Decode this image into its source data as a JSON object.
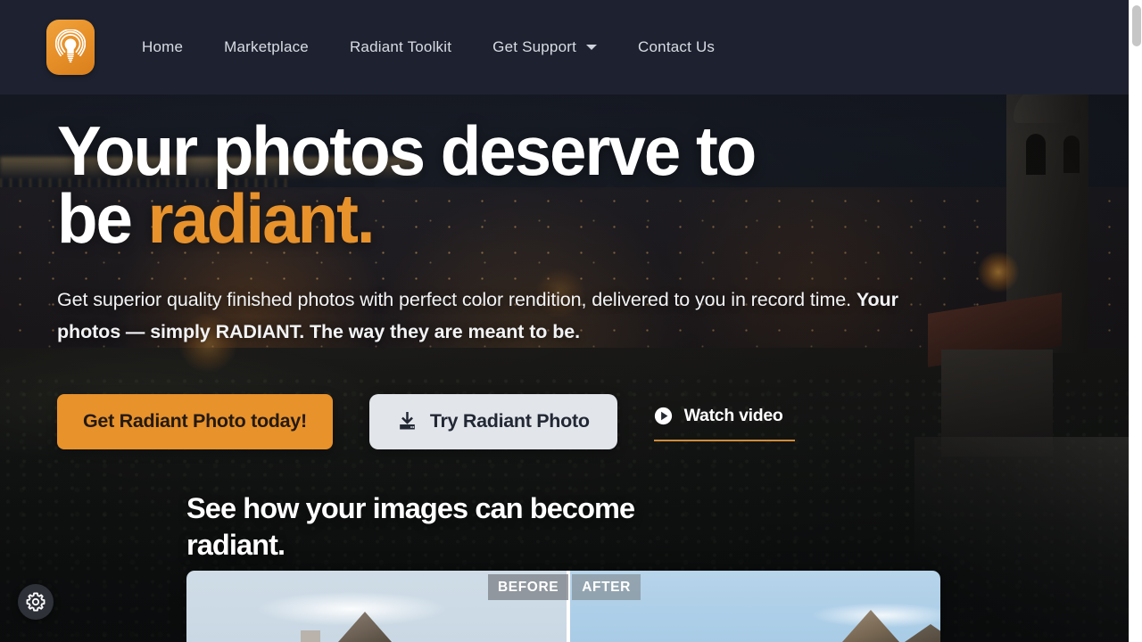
{
  "navbar": {
    "logo_icon": "radiant-bulb-logo",
    "links": [
      {
        "label": "Home",
        "has_caret": false
      },
      {
        "label": "Marketplace",
        "has_caret": false
      },
      {
        "label": "Radiant Toolkit",
        "has_caret": false
      },
      {
        "label": "Get Support",
        "has_caret": true
      },
      {
        "label": "Contact Us",
        "has_caret": false
      }
    ],
    "background_color": "#1e2230"
  },
  "hero": {
    "headline_line1": "Your photos deserve to",
    "headline_line2_plain": "be ",
    "headline_line2_accent": "radiant.",
    "subhead_plain": "Get superior quality finished photos with perfect color rendition, delivered to you in record time. ",
    "subhead_bold": "Your photos — simply RADIANT. The way they are meant to be.",
    "accent_color": "#e8922c"
  },
  "cta": {
    "primary_label": "Get Radiant Photo today!",
    "secondary_label": "Try Radiant Photo",
    "secondary_icon": "download-icon",
    "watch_label": "Watch video",
    "watch_icon": "play-circle-icon"
  },
  "section": {
    "title_line1": "See how your images can become",
    "title_line2": "radiant."
  },
  "compare": {
    "before_label": "BEFORE",
    "after_label": "AFTER",
    "divider_color": "#ffffff"
  },
  "footer_widget": {
    "gear_icon": "gear-icon"
  }
}
